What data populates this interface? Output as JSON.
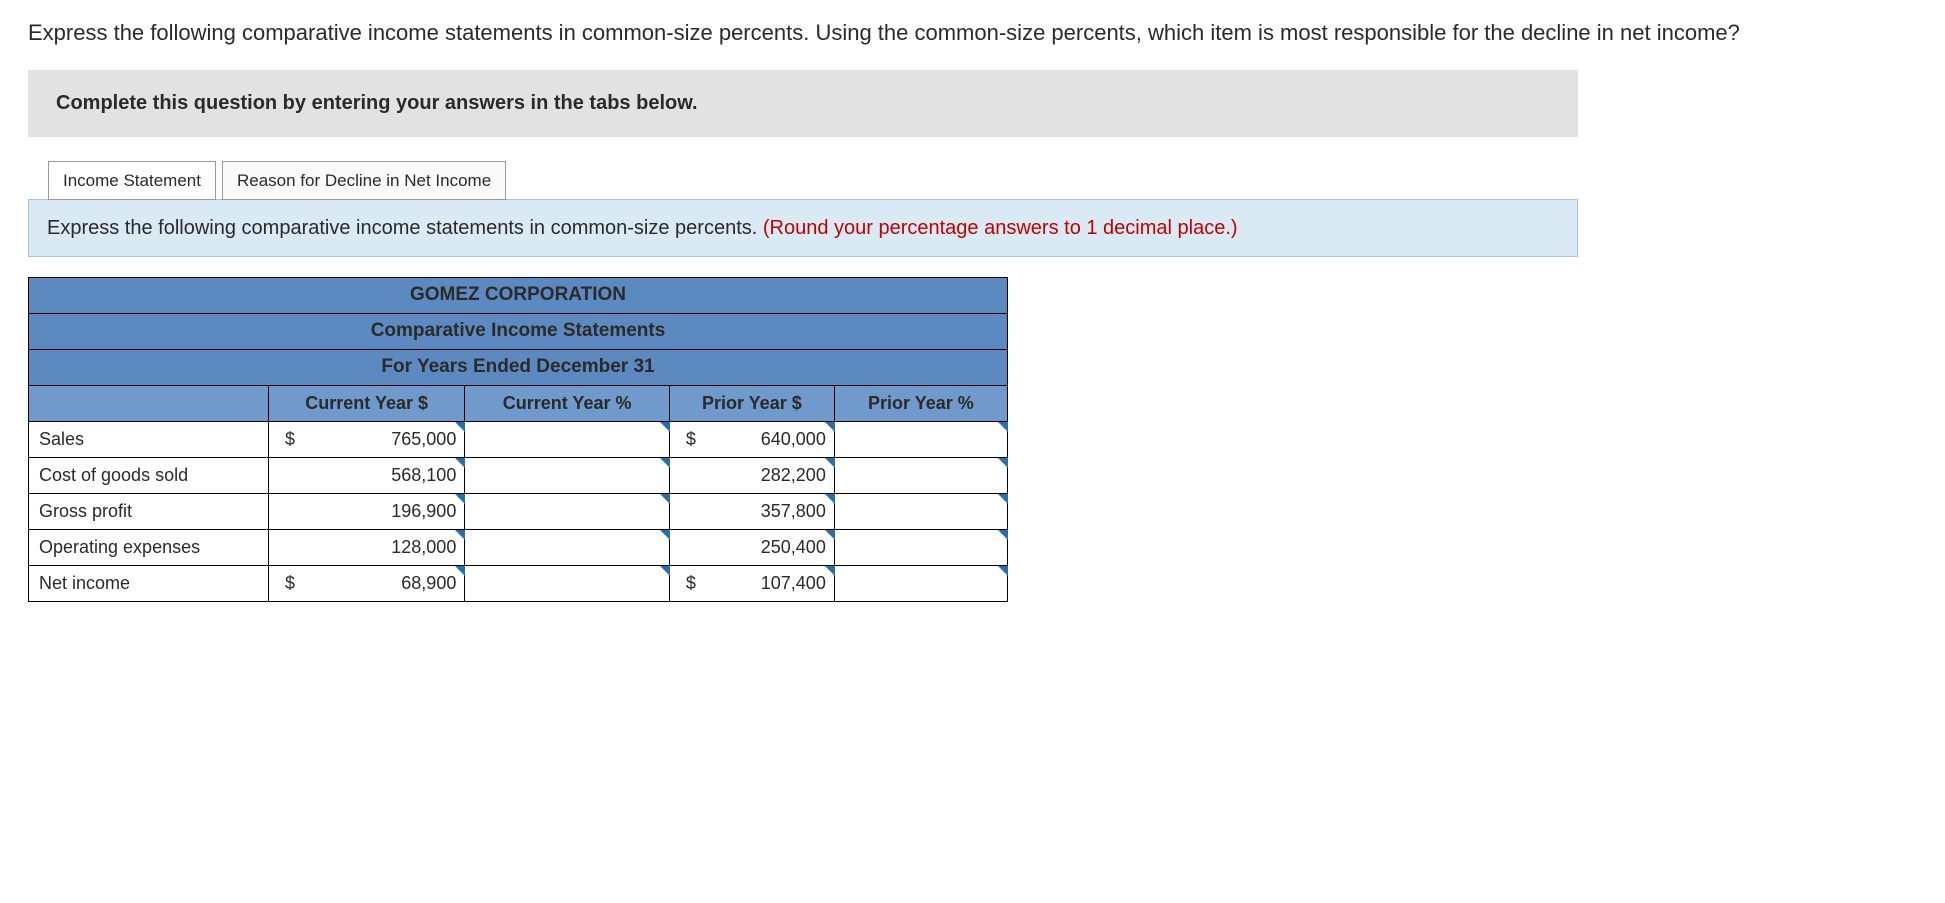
{
  "question": "Express the following comparative income statements in common-size percents. Using the common-size percents, which item is most responsible for the decline in net income?",
  "banner": "Complete this question by entering your answers in the tabs below.",
  "tabs": [
    {
      "label": "Income Statement"
    },
    {
      "label": "Reason for Decline in Net Income"
    }
  ],
  "sub_instruction_main": "Express the following comparative income statements in common-size percents. ",
  "sub_instruction_red": "(Round your percentage answers to 1 decimal place.)",
  "table": {
    "title1": "GOMEZ CORPORATION",
    "title2": "Comparative Income Statements",
    "title3": "For Years Ended December 31",
    "cols": [
      "Current Year $",
      "Current Year %",
      "Prior Year $",
      "Prior Year %"
    ],
    "rows": [
      {
        "label": "Sales",
        "cy_sym": "$",
        "cy": "765,000",
        "py_sym": "$",
        "py": "640,000"
      },
      {
        "label": "Cost of goods sold",
        "cy_sym": "",
        "cy": "568,100",
        "py_sym": "",
        "py": "282,200"
      },
      {
        "label": "Gross profit",
        "cy_sym": "",
        "cy": "196,900",
        "py_sym": "",
        "py": "357,800"
      },
      {
        "label": "Operating expenses",
        "cy_sym": "",
        "cy": "128,000",
        "py_sym": "",
        "py": "250,400"
      },
      {
        "label": "Net income",
        "cy_sym": "$",
        "cy": "68,900",
        "py_sym": "$",
        "py": "107,400"
      }
    ]
  }
}
